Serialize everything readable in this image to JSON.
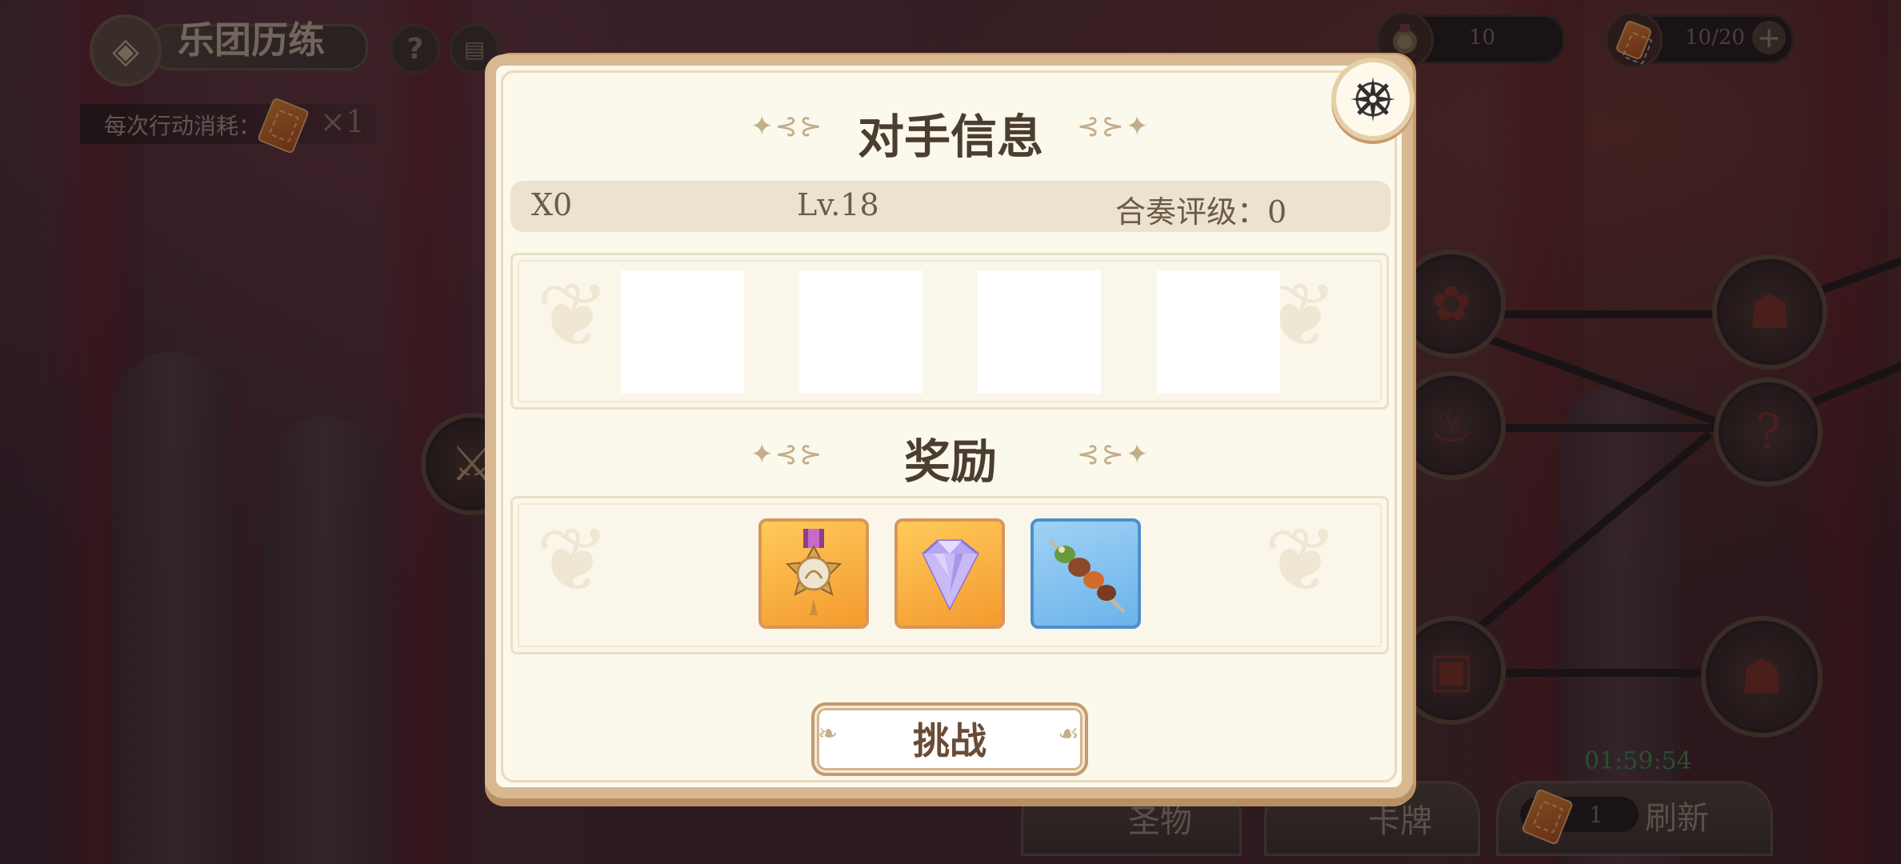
{
  "header": {
    "title": "乐团历练",
    "help_icon": "?",
    "cost_label": "每次行动消耗：",
    "cost_multiplier": "×1"
  },
  "resources": {
    "medal_count": "10",
    "ticket_count": "10/20",
    "plus_icon": "+"
  },
  "dialog": {
    "title": "对手信息",
    "opponent": {
      "name": "X0",
      "level": "Lv.18",
      "rating": "合奏评级：0"
    },
    "rewards_title": "奖励",
    "rewards": [
      "medal-icon",
      "crystal-icon",
      "skewer-icon"
    ],
    "challenge_label": "挑战"
  },
  "bottom": {
    "relic_label": "圣物",
    "cards_label": "卡牌",
    "refresh_label": "刷新",
    "refresh_count": "1",
    "timer": "01:59:54"
  },
  "colors": {
    "dialog_bg": "#fbf8ec",
    "dialog_border": "#d7b890",
    "reward_gold": "#f5a83a",
    "reward_blue": "#7fc0ee",
    "timer_green": "#3a8e4a"
  }
}
